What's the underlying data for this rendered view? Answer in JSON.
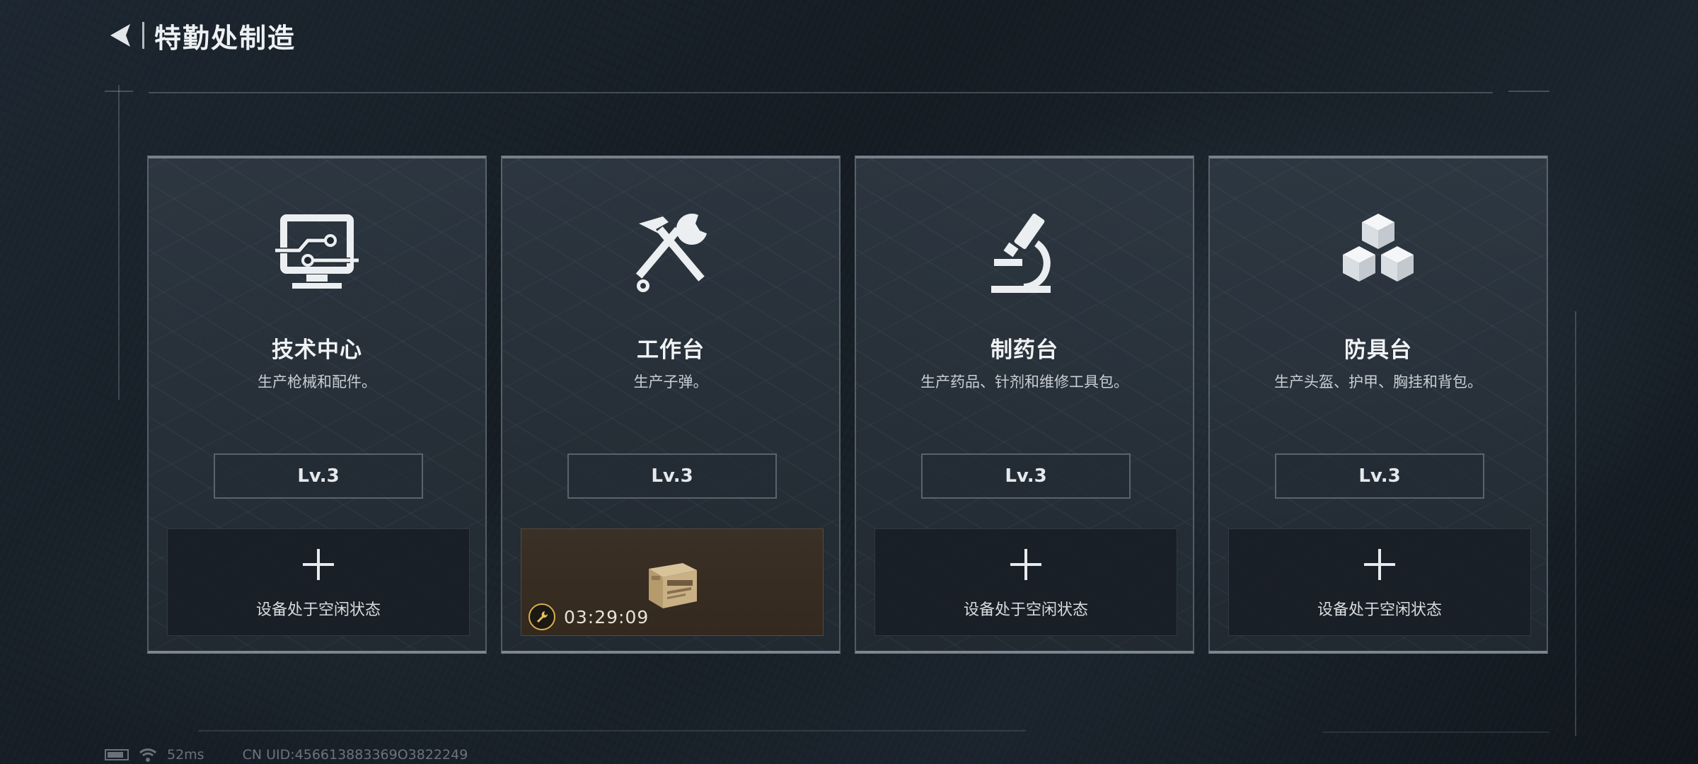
{
  "header": {
    "title": "特勤处制造",
    "back_icon": "back-arrow-icon"
  },
  "stations": [
    {
      "name": "技术中心",
      "description": "生产枪械和配件。",
      "icon": "monitor-circuit-icon",
      "level": "Lv.3",
      "slot": {
        "state": "idle",
        "label": "设备处于空闲状态"
      }
    },
    {
      "name": "工作台",
      "description": "生产子弹。",
      "icon": "hammer-wrench-icon",
      "level": "Lv.3",
      "slot": {
        "state": "producing",
        "item_icon": "ammo-box-icon",
        "timer": "03:29:09"
      }
    },
    {
      "name": "制药台",
      "description": "生产药品、针剂和维修工具包。",
      "icon": "microscope-icon",
      "level": "Lv.3",
      "slot": {
        "state": "idle",
        "label": "设备处于空闲状态"
      }
    },
    {
      "name": "防具台",
      "description": "生产头盔、护甲、胸挂和背包。",
      "icon": "cubes-icon",
      "level": "Lv.3",
      "slot": {
        "state": "idle",
        "label": "设备处于空闲状态"
      }
    }
  ],
  "status_bar": {
    "ping": "52ms",
    "uid": "CN UID:456613883369O3822249"
  },
  "colors": {
    "background": "#1a222b",
    "busy_slot": "#3b3026",
    "timer_accent": "#d8b048"
  }
}
